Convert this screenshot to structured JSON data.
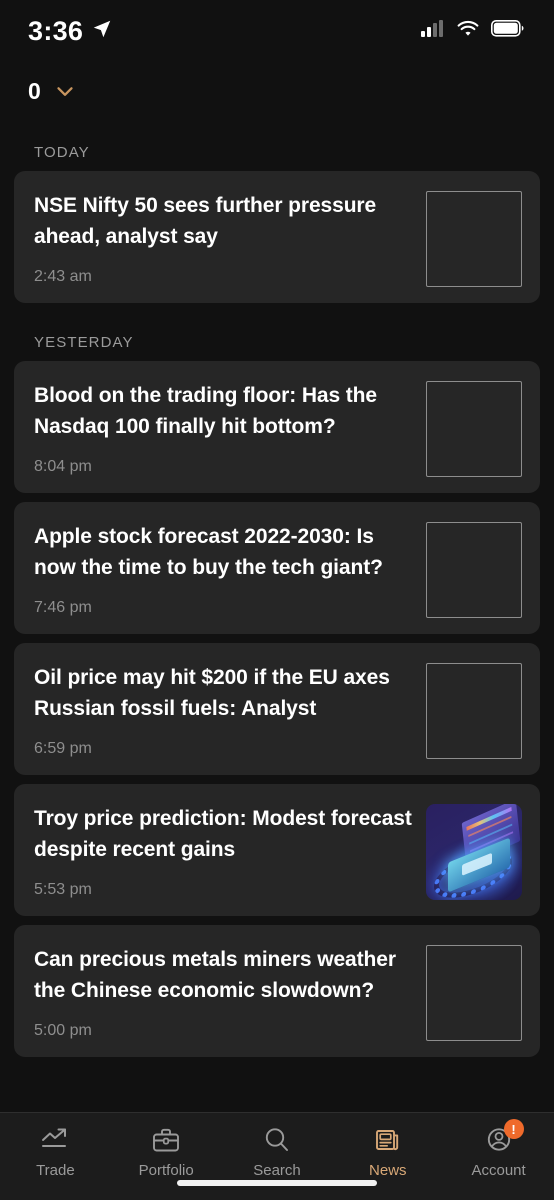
{
  "status_bar": {
    "time": "3:36",
    "location_icon": "location-arrow-icon",
    "cellular_icon": "cellular-signal-icon",
    "wifi_icon": "wifi-icon",
    "battery_icon": "battery-icon"
  },
  "header": {
    "count": "0",
    "chevron_icon": "chevron-down-icon",
    "accent_color": "#c8955f"
  },
  "theme": {
    "page_background": "#111111",
    "card_background": "#262626",
    "accent": "#d8a877",
    "badge": "#ef6a2b",
    "title_color": "#ffffff",
    "muted_color": "#8e8e8e"
  },
  "sections": [
    {
      "label": "TODAY",
      "articles": [
        {
          "title": "NSE Nifty 50 sees further pressure ahead, analyst say",
          "time": "2:43 am",
          "thumbnail": "placeholder"
        }
      ]
    },
    {
      "label": "YESTERDAY",
      "articles": [
        {
          "title": "Blood on the trading floor: Has the Nasdaq 100 finally hit bottom?",
          "time": "8:04 pm",
          "thumbnail": "placeholder"
        },
        {
          "title": "Apple stock forecast 2022-2030: Is now the time to buy the tech giant?",
          "time": "7:46 pm",
          "thumbnail": "placeholder"
        },
        {
          "title": "Oil price may hit $200 if the EU axes Russian fossil fuels: Analyst",
          "time": "6:59 pm",
          "thumbnail": "placeholder"
        },
        {
          "title": "Troy price prediction: Modest forecast despite recent gains",
          "time": "5:53 pm",
          "thumbnail": "image-isometric-laptop-charts"
        },
        {
          "title": "Can precious metals miners weather the Chinese economic slowdown?",
          "time": "5:00 pm",
          "thumbnail": "placeholder"
        }
      ]
    }
  ],
  "tabbar": {
    "items": [
      {
        "label": "Trade",
        "icon": "trending-up-icon",
        "active": false,
        "badge": ""
      },
      {
        "label": "Portfolio",
        "icon": "briefcase-icon",
        "active": false,
        "badge": ""
      },
      {
        "label": "Search",
        "icon": "search-icon",
        "active": false,
        "badge": ""
      },
      {
        "label": "News",
        "icon": "newspaper-icon",
        "active": true,
        "badge": ""
      },
      {
        "label": "Account",
        "icon": "user-circle-icon",
        "active": false,
        "badge": "!"
      }
    ]
  }
}
